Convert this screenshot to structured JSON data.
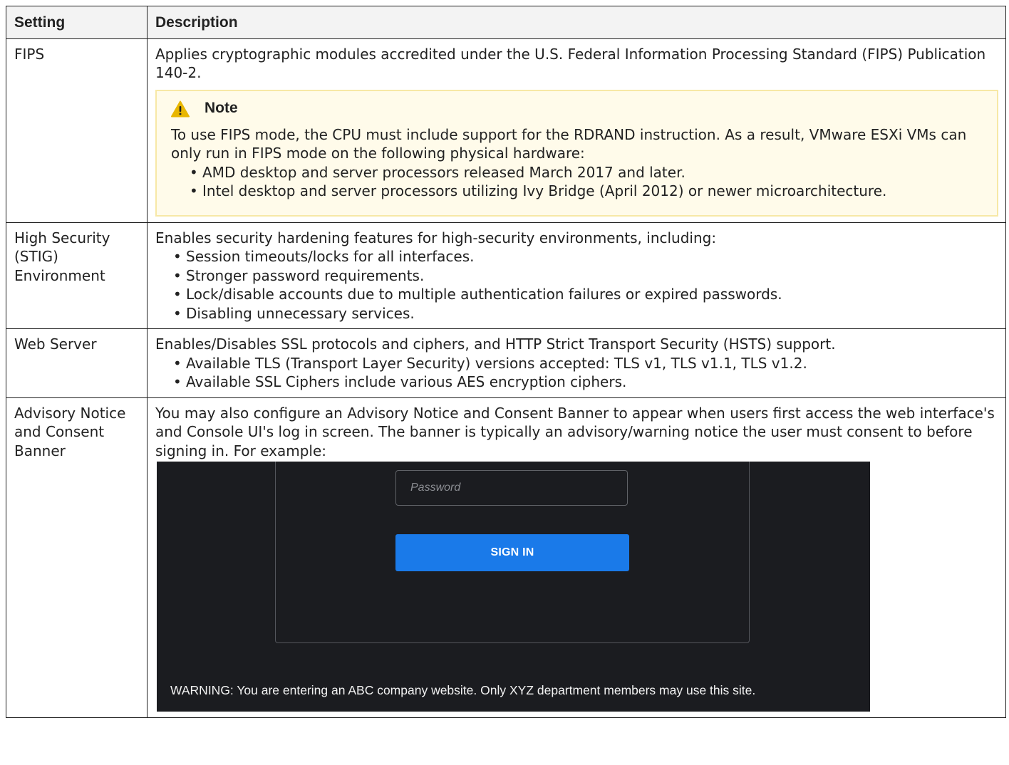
{
  "table": {
    "headers": {
      "setting": "Setting",
      "description": "Description"
    },
    "rows": [
      {
        "setting": "FIPS",
        "intro": "Applies cryptographic modules accredited under the U.S. Federal Information Processing Standard (FIPS) Publication 140-2.",
        "note": {
          "icon": "warning-icon",
          "title": "Note",
          "text": "To use FIPS mode, the CPU must include support for the RDRAND instruction. As a result, VMware ESXi VMs can only run in FIPS mode on the following physical hardware:",
          "bullets": [
            "AMD desktop and server processors released March 2017 and later.",
            "Intel desktop and server processors utilizing Ivy Bridge (April 2012) or newer microarchitecture."
          ]
        }
      },
      {
        "setting": "High Security (STIG) Environment",
        "intro": "Enables security hardening features for high-security environments, including:",
        "bullets": [
          "Session timeouts/locks for all interfaces.",
          "Stronger password requirements.",
          "Lock/disable accounts due to multiple authentication failures or expired passwords.",
          "Disabling unnecessary services."
        ]
      },
      {
        "setting": "Web Server",
        "intro": "Enables/Disables SSL protocols and ciphers, and HTTP Strict Transport Security (HSTS) support.",
        "bullets": [
          "Available TLS (Transport Layer Security) versions accepted: TLS v1, TLS v1.1, TLS v1.2.",
          "Available SSL Ciphers include various AES encryption ciphers."
        ]
      },
      {
        "setting": "Advisory Notice and Consent Banner",
        "intro": "You may also configure an Advisory Notice and Consent Banner to appear when users first access the web interface's and Console UI's log in screen. The banner is typically an advisory/warning notice the user must consent to before signing in. For example:",
        "example": {
          "password_placeholder": "Password",
          "sign_in_label": "SIGN IN",
          "warning_text": "WARNING: You are entering an ABC company website. Only XYZ department members may use this site."
        }
      }
    ]
  },
  "colors": {
    "note_background": "#fffbea",
    "note_border": "#f7e8a6",
    "warning_icon": "#e8b600",
    "example_background": "#1b1c20",
    "sign_in_button": "#1a7ae9"
  }
}
